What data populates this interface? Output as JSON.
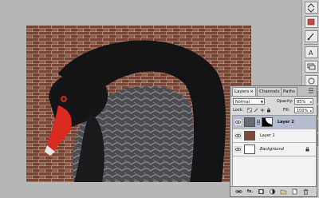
{
  "panel": {
    "tabs": [
      {
        "label": "Layers",
        "close": "×"
      },
      {
        "label": "Channels"
      },
      {
        "label": "Paths"
      }
    ],
    "blend_mode": "Normal",
    "opacity_label": "Opacity:",
    "opacity_value": "85%",
    "lock_label": "Lock:",
    "fill_label": "Fill:",
    "fill_value": "100%",
    "layers": [
      {
        "name": "Layer 2",
        "selected": true
      },
      {
        "name": "Layer 1",
        "selected": false
      },
      {
        "name": "Background",
        "selected": false,
        "locked": true
      }
    ],
    "bottom_icons": [
      "link-icon",
      "fx-icon",
      "mask-icon",
      "adjustment-icon",
      "folder-icon",
      "new-layer-icon",
      "trash-icon"
    ],
    "bottom_labels": {
      "fx": "fx."
    }
  },
  "toolbar": {
    "tools": [
      "arrows-icon",
      "swatch-icon",
      "brush-icon",
      "text-icon",
      "layers-icon",
      "tool-6-icon",
      "tool-7-icon",
      "tool-8-icon",
      "tool-9-icon",
      "tool-10-icon"
    ]
  },
  "colors": {
    "workspace": "#b6b6b6",
    "panel": "#d9d9d9",
    "selected_layer": "#b4bdcf",
    "brick": "#7d4a37",
    "beak": "#d92b1f"
  }
}
